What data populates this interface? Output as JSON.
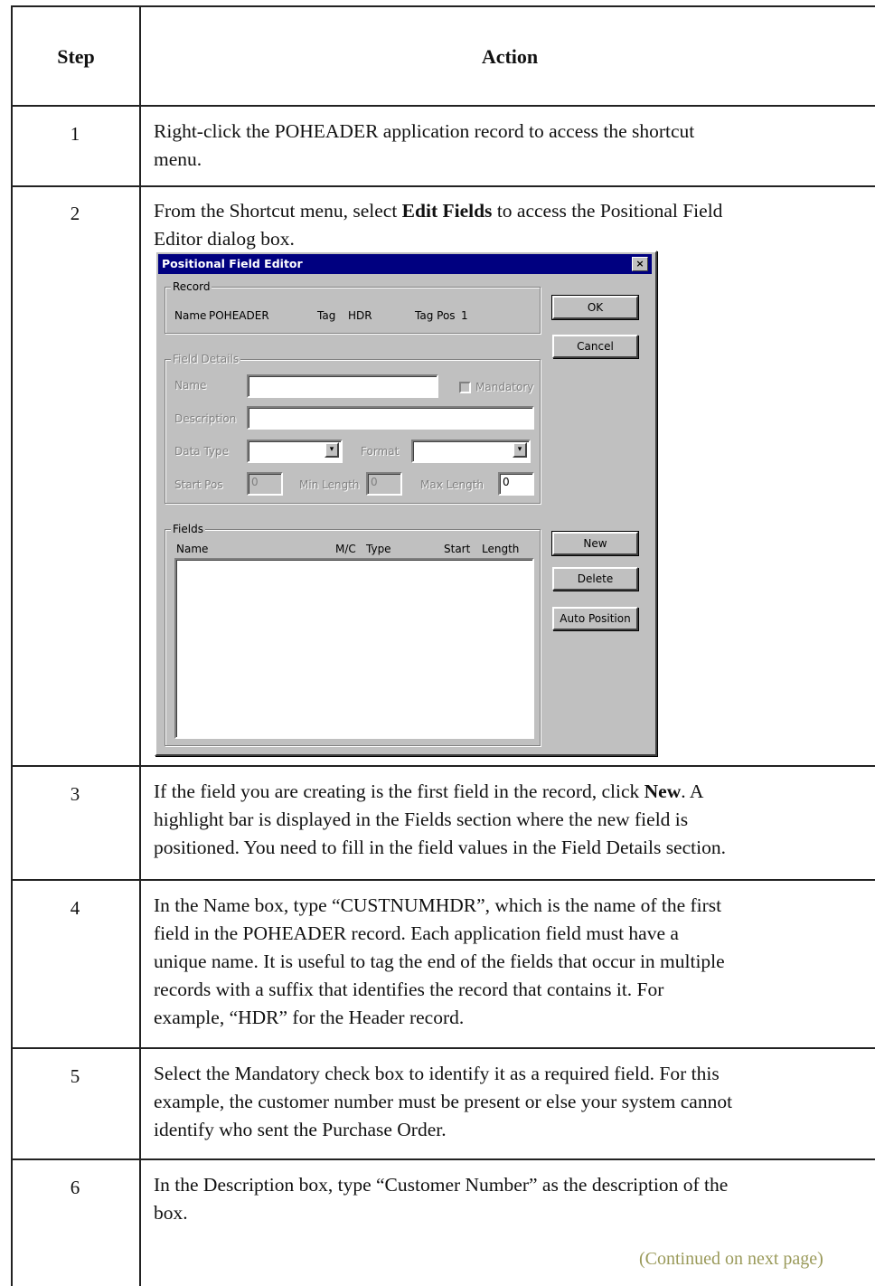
{
  "table": {
    "header_step": "Step",
    "header_action": "Action",
    "rows": [
      {
        "step": "1",
        "lines": [
          "Right-click the POHEADER application record to access the shortcut",
          "menu."
        ]
      },
      {
        "step": "2",
        "pre": "From the Shortcut menu, select ",
        "bold": "Edit Fields",
        "post": " to access the Positional Field",
        "line2": "Editor dialog box."
      },
      {
        "step": "3",
        "pre": "If the field you are creating is the first field in the record, click ",
        "bold": "New",
        "post": ". A",
        "line2": "highlight bar is displayed in the Fields section where the new field is",
        "line3": "positioned. You need to fill in the field values in the Field Details section."
      },
      {
        "step": "4",
        "lines": [
          "In the Name box, type “CUSTNUMHDR”, which is the name of the first",
          "field in the POHEADER record. Each application field must have a",
          "unique name. It is useful to tag the end of the fields that occur in multiple",
          "records with a suffix that identifies the record that contains it. For",
          "example, “HDR” for the Header record."
        ]
      },
      {
        "step": "5",
        "lines": [
          "Select the Mandatory check box to identify it as a required field. For this",
          "example, the customer number must be present or else your system cannot",
          "identify who sent the Purchase Order."
        ]
      },
      {
        "step": "6",
        "lines": [
          "In the Description box, type “Customer Number” as the description of the",
          "box."
        ]
      }
    ],
    "continued": "(Continued on next page)"
  },
  "dialog": {
    "title": "Positional Field Editor",
    "close": "×",
    "record_group": "Record",
    "record_name_label": "Name",
    "record_name_value": "POHEADER",
    "record_tag_label": "Tag",
    "record_tag_value": "HDR",
    "record_tagpos_label": "Tag Pos",
    "record_tagpos_value": "1",
    "ok": "OK",
    "cancel": "Cancel",
    "field_details_group": "Field Details",
    "name_label": "Name",
    "mandatory_label": "Mandatory",
    "description_label": "Description",
    "data_type_label": "Data Type",
    "format_label": "Format",
    "start_pos_label": "Start Pos",
    "start_pos_value": "0",
    "min_length_label": "Min Length",
    "min_length_value": "0",
    "max_length_label": "Max Length",
    "max_length_value": "0",
    "fields_group": "Fields",
    "col_name": "Name",
    "col_mc": "M/C",
    "col_type": "Type",
    "col_start": "Start",
    "col_length": "Length",
    "new": "New",
    "delete": "Delete",
    "auto_position": "Auto Position"
  }
}
